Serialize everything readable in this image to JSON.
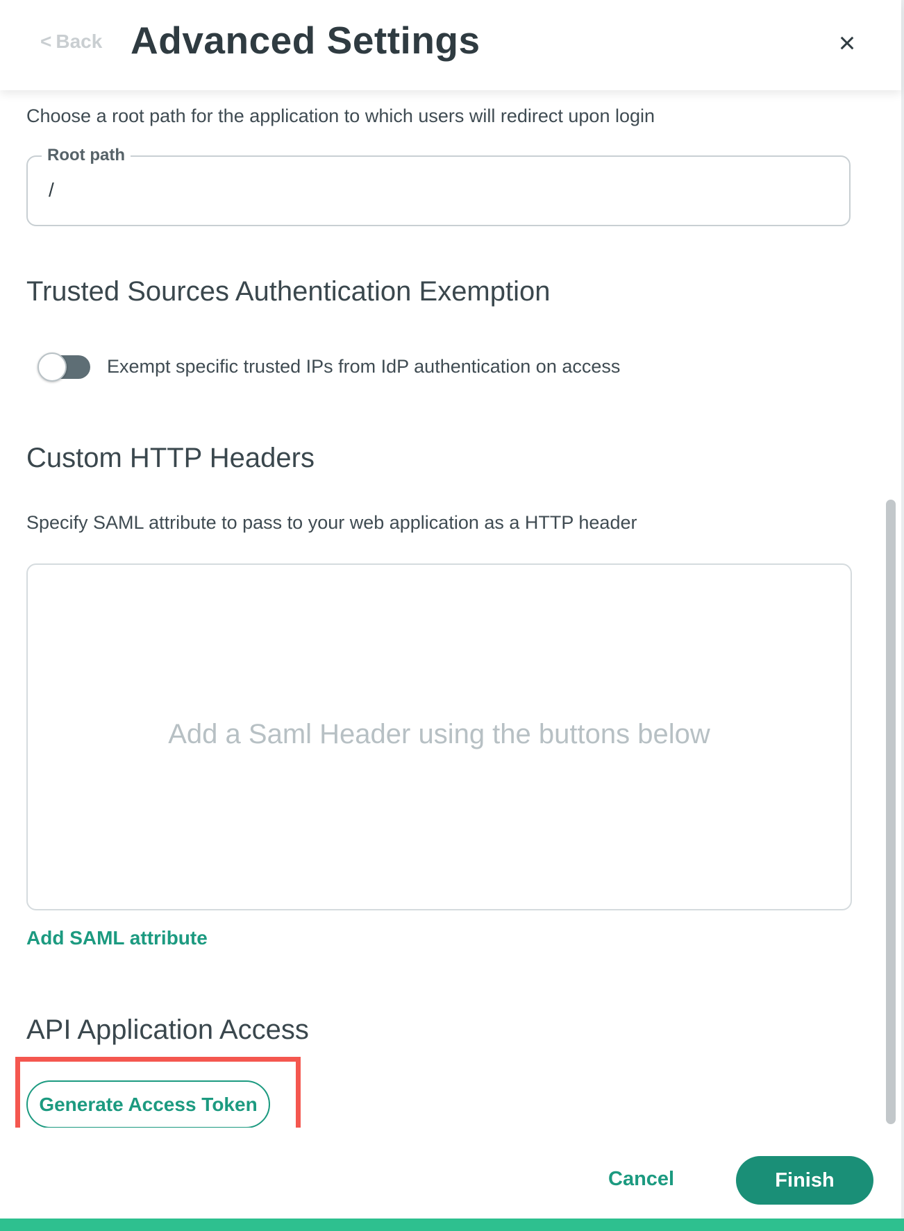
{
  "header": {
    "back_chevron": "<",
    "back_label": "Back",
    "title": "Advanced Settings",
    "close_glyph": "×"
  },
  "root_path": {
    "description": "Choose a root path for the application to which users will redirect upon login",
    "field_label": "Root path",
    "field_value": "/"
  },
  "trusted_sources": {
    "title": "Trusted Sources Authentication Exemption",
    "toggle_label": "Exempt specific trusted IPs from IdP authentication on access",
    "toggle_enabled": false
  },
  "custom_headers": {
    "title": "Custom HTTP Headers",
    "description": "Specify SAML attribute to pass to your web application as a HTTP header",
    "empty_placeholder": "Add a Saml Header using the buttons below",
    "add_link": "Add SAML attribute"
  },
  "api_access": {
    "title": "API Application Access",
    "generate_button": "Generate Access Token"
  },
  "footer": {
    "cancel_label": "Cancel",
    "finish_label": "Finish"
  },
  "colors": {
    "accent_green": "#1c9a80",
    "finish_bg": "#1a8f77",
    "highlight_red": "#f4574f",
    "bottom_bar": "#2ec08f"
  }
}
